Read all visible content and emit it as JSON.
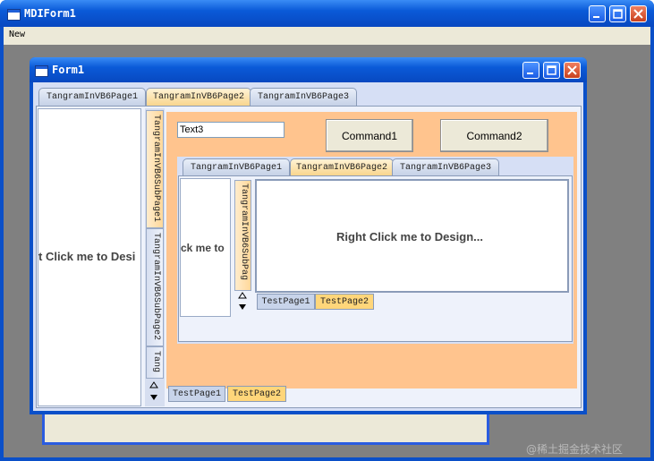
{
  "mdi": {
    "title": "MDIForm1",
    "menu": {
      "items": [
        "New"
      ]
    }
  },
  "form1": {
    "title": "Form1",
    "tabs": [
      "TangramInVB6Page1",
      "TangramInVB6Page2",
      "TangramInVB6Page3"
    ],
    "active_tab": "TangramInVB6Page2",
    "left_panel_text": "t Click me to Desi",
    "vtabs": [
      "TangramInVB6SubPage1",
      "TangramInVB6SubPage2",
      "Tang"
    ],
    "text_box_value": "Text3",
    "command1_label": "Command1",
    "command2_label": "Command2",
    "inner_tabs": [
      "TangramInVB6Page1",
      "TangramInVB6Page2",
      "TangramInVB6Page3"
    ],
    "inner_left_text": "ck me to",
    "inner_vtab": "TangramInVB6SubPag",
    "design_text": "Right Click me to Design...",
    "inner_bottom_tabs": [
      "TestPage1",
      "TestPage2"
    ],
    "outer_bottom_tabs": [
      "TestPage1",
      "TestPage2"
    ]
  },
  "watermark": "@稀土掘金技术社区",
  "colors": {
    "desktop": "#808080",
    "peach": "#ffc48e",
    "xp_blue": "#0a5ad8",
    "active_tab": "#ffd67a"
  }
}
